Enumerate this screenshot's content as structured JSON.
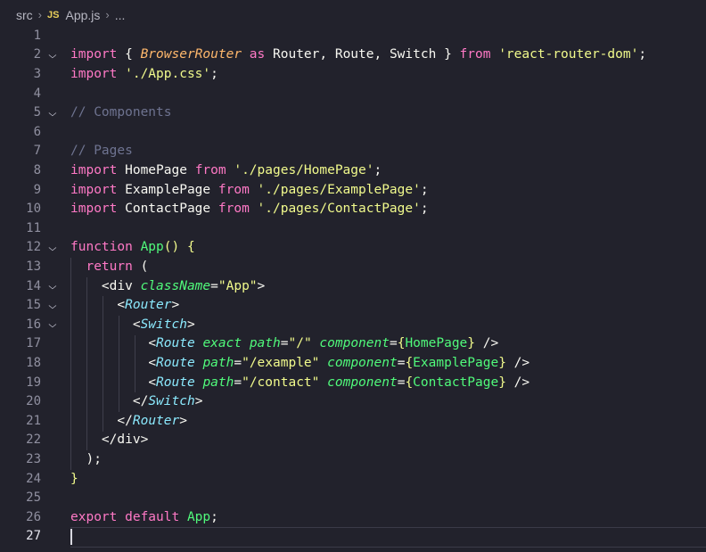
{
  "breadcrumb": {
    "folder": "src",
    "file_icon": "JS",
    "file": "App.js",
    "more": "..."
  },
  "editor": {
    "active_line": 27,
    "lines": [
      {
        "n": "1",
        "fold": false,
        "tokens": []
      },
      {
        "n": "2",
        "fold": true,
        "tokens": [
          [
            "kw",
            "import "
          ],
          [
            "punc",
            "{ "
          ],
          [
            "cls",
            "BrowserRouter"
          ],
          [
            "kw",
            " as "
          ],
          [
            "plain",
            "Router, Route, Switch "
          ],
          [
            "punc",
            "} "
          ],
          [
            "kw",
            "from "
          ],
          [
            "str",
            "'react-router-dom'"
          ],
          [
            "punc",
            ";"
          ]
        ]
      },
      {
        "n": "3",
        "fold": false,
        "tokens": [
          [
            "kw",
            "import "
          ],
          [
            "str",
            "'./App.css'"
          ],
          [
            "punc",
            ";"
          ]
        ]
      },
      {
        "n": "4",
        "fold": false,
        "tokens": []
      },
      {
        "n": "5",
        "fold": true,
        "tokens": [
          [
            "cmt",
            "// Components"
          ]
        ]
      },
      {
        "n": "6",
        "fold": false,
        "tokens": []
      },
      {
        "n": "7",
        "fold": false,
        "tokens": [
          [
            "cmt",
            "// Pages"
          ]
        ]
      },
      {
        "n": "8",
        "fold": false,
        "tokens": [
          [
            "kw",
            "import "
          ],
          [
            "plain",
            "HomePage "
          ],
          [
            "kw",
            "from "
          ],
          [
            "str",
            "'./pages/HomePage'"
          ],
          [
            "punc",
            ";"
          ]
        ]
      },
      {
        "n": "9",
        "fold": false,
        "tokens": [
          [
            "kw",
            "import "
          ],
          [
            "plain",
            "ExamplePage "
          ],
          [
            "kw",
            "from "
          ],
          [
            "str",
            "'./pages/ExamplePage'"
          ],
          [
            "punc",
            ";"
          ]
        ]
      },
      {
        "n": "10",
        "fold": false,
        "tokens": [
          [
            "kw",
            "import "
          ],
          [
            "plain",
            "ContactPage "
          ],
          [
            "kw",
            "from "
          ],
          [
            "str",
            "'./pages/ContactPage'"
          ],
          [
            "punc",
            ";"
          ]
        ]
      },
      {
        "n": "11",
        "fold": false,
        "tokens": []
      },
      {
        "n": "12",
        "fold": true,
        "tokens": [
          [
            "kw",
            "function "
          ],
          [
            "fn",
            "App"
          ],
          [
            "br",
            "() {"
          ]
        ]
      },
      {
        "n": "13",
        "fold": false,
        "tokens": [
          [
            "plain",
            "  "
          ],
          [
            "kw",
            "return "
          ],
          [
            "punc",
            "("
          ]
        ]
      },
      {
        "n": "14",
        "fold": true,
        "tokens": [
          [
            "plain",
            "    "
          ],
          [
            "punc",
            "<"
          ],
          [
            "plain",
            "div "
          ],
          [
            "attr",
            "className"
          ],
          [
            "punc",
            "="
          ],
          [
            "str",
            "\"App\""
          ],
          [
            "punc",
            ">"
          ]
        ]
      },
      {
        "n": "15",
        "fold": true,
        "tokens": [
          [
            "plain",
            "      "
          ],
          [
            "punc",
            "<"
          ],
          [
            "tag",
            "Router"
          ],
          [
            "punc",
            ">"
          ]
        ]
      },
      {
        "n": "16",
        "fold": true,
        "tokens": [
          [
            "plain",
            "        "
          ],
          [
            "punc",
            "<"
          ],
          [
            "tag",
            "Switch"
          ],
          [
            "punc",
            ">"
          ]
        ]
      },
      {
        "n": "17",
        "fold": false,
        "tokens": [
          [
            "plain",
            "          "
          ],
          [
            "punc",
            "<"
          ],
          [
            "tag",
            "Route "
          ],
          [
            "attr",
            "exact path"
          ],
          [
            "punc",
            "="
          ],
          [
            "str",
            "\"/\" "
          ],
          [
            "attr",
            "component"
          ],
          [
            "punc",
            "="
          ],
          [
            "br",
            "{"
          ],
          [
            "fn",
            "HomePage"
          ],
          [
            "br",
            "}"
          ],
          [
            "punc",
            " />"
          ]
        ]
      },
      {
        "n": "18",
        "fold": false,
        "tokens": [
          [
            "plain",
            "          "
          ],
          [
            "punc",
            "<"
          ],
          [
            "tag",
            "Route "
          ],
          [
            "attr",
            "path"
          ],
          [
            "punc",
            "="
          ],
          [
            "str",
            "\"/example\" "
          ],
          [
            "attr",
            "component"
          ],
          [
            "punc",
            "="
          ],
          [
            "br",
            "{"
          ],
          [
            "fn",
            "ExamplePage"
          ],
          [
            "br",
            "}"
          ],
          [
            "punc",
            " />"
          ]
        ]
      },
      {
        "n": "19",
        "fold": false,
        "tokens": [
          [
            "plain",
            "          "
          ],
          [
            "punc",
            "<"
          ],
          [
            "tag",
            "Route "
          ],
          [
            "attr",
            "path"
          ],
          [
            "punc",
            "="
          ],
          [
            "str",
            "\"/contact\" "
          ],
          [
            "attr",
            "component"
          ],
          [
            "punc",
            "="
          ],
          [
            "br",
            "{"
          ],
          [
            "fn",
            "ContactPage"
          ],
          [
            "br",
            "}"
          ],
          [
            "punc",
            " />"
          ]
        ]
      },
      {
        "n": "20",
        "fold": false,
        "tokens": [
          [
            "plain",
            "        "
          ],
          [
            "punc",
            "</"
          ],
          [
            "tag",
            "Switch"
          ],
          [
            "punc",
            ">"
          ]
        ]
      },
      {
        "n": "21",
        "fold": false,
        "tokens": [
          [
            "plain",
            "      "
          ],
          [
            "punc",
            "</"
          ],
          [
            "tag",
            "Router"
          ],
          [
            "punc",
            ">"
          ]
        ]
      },
      {
        "n": "22",
        "fold": false,
        "tokens": [
          [
            "plain",
            "    "
          ],
          [
            "punc",
            "</"
          ],
          [
            "plain",
            "div"
          ],
          [
            "punc",
            ">"
          ]
        ]
      },
      {
        "n": "23",
        "fold": false,
        "tokens": [
          [
            "plain",
            "  "
          ],
          [
            "punc",
            ");"
          ]
        ]
      },
      {
        "n": "24",
        "fold": false,
        "tokens": [
          [
            "br",
            "}"
          ]
        ]
      },
      {
        "n": "25",
        "fold": false,
        "tokens": []
      },
      {
        "n": "26",
        "fold": false,
        "tokens": [
          [
            "kw",
            "export default "
          ],
          [
            "fn",
            "App"
          ],
          [
            "punc",
            ";"
          ]
        ]
      },
      {
        "n": "27",
        "fold": false,
        "tokens": []
      }
    ]
  },
  "colors": {
    "background": "#22222c",
    "keyword": "#ff79c6",
    "function": "#50fa7b",
    "string": "#f1fa8c",
    "comment": "#6e7390",
    "tag": "#8be9fd",
    "class": "#ffb86c"
  }
}
